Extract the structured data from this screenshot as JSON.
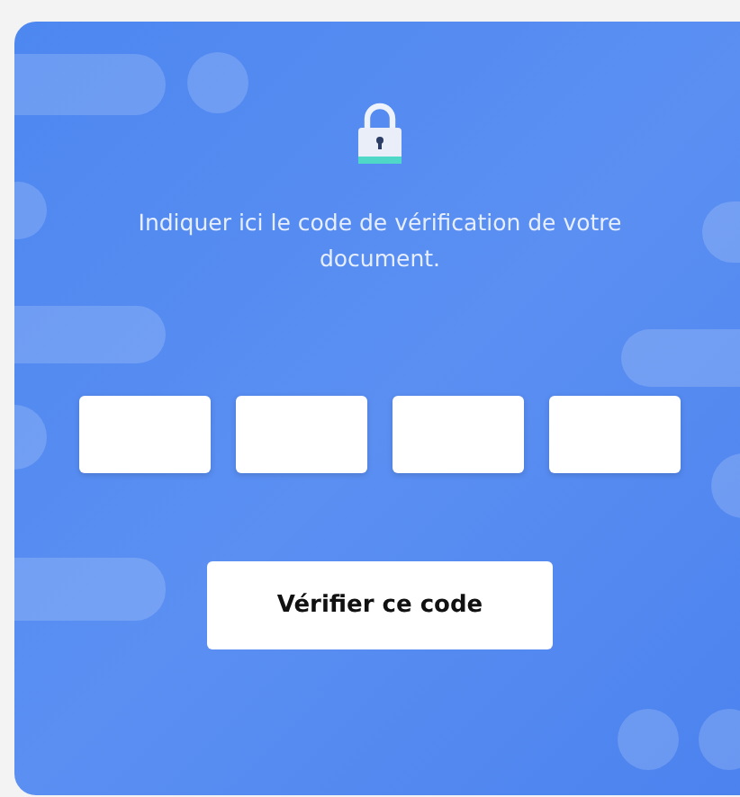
{
  "prompt": "Indiquer ici le code de vérification de votre document.",
  "code_fields": [
    {
      "kind": "digit"
    },
    {
      "kind": "digit"
    },
    {
      "kind": "digit"
    },
    {
      "kind": "digit"
    }
  ],
  "submit_button": {
    "label": "Vérifier ce code"
  }
}
